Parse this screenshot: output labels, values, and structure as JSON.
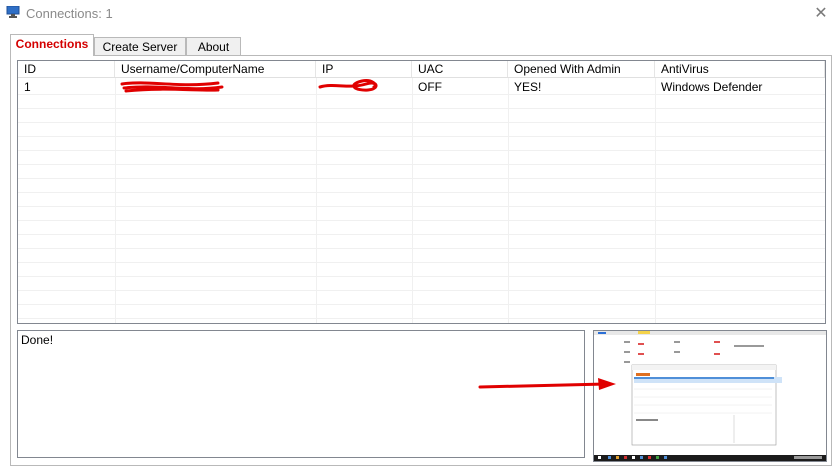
{
  "window": {
    "title": "Connections: 1",
    "close_glyph": "✕"
  },
  "tabs": [
    {
      "label": "Connections",
      "active": true
    },
    {
      "label": "Create Server",
      "active": false
    },
    {
      "label": "About",
      "active": false
    }
  ],
  "table": {
    "columns": [
      "ID",
      "Username/ComputerName",
      "IP",
      "UAC",
      "Opened With Admin",
      "AntiVirus"
    ],
    "rows": [
      {
        "id": "1",
        "username": "",
        "ip": "",
        "uac": "OFF",
        "admin": "YES!",
        "antivirus": "Windows Defender"
      }
    ]
  },
  "log": {
    "text": "Done!"
  },
  "colors": {
    "active_tab": "#d40000",
    "redaction": "#e00000",
    "arrow": "#e00000"
  },
  "icons": {
    "app": "monitor-icon",
    "close": "close-icon"
  }
}
